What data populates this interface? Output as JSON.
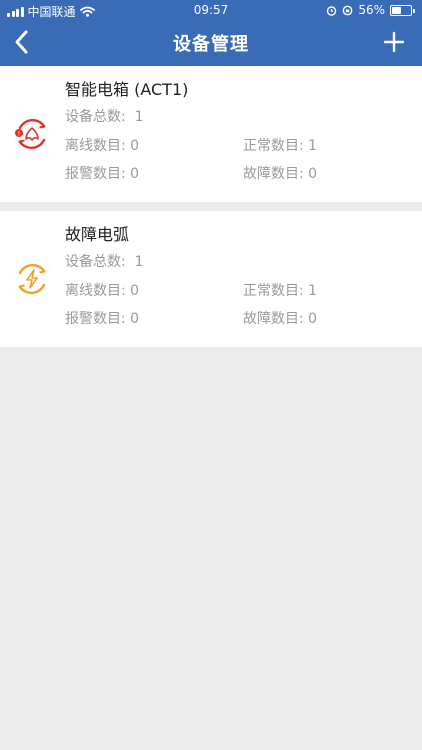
{
  "status_bar": {
    "carrier": "中国联通",
    "time": "09:57",
    "battery": "56%",
    "battery_level": 0.56
  },
  "header": {
    "title": "设备管理",
    "back_icon": "chevron-left-icon",
    "add_icon": "plus-icon"
  },
  "devices": [
    {
      "name": "智能电箱 (ACT1)",
      "icon": "smart-box-icon",
      "color": "#e0332d",
      "total_label": "设备总数:  ",
      "total": "1",
      "offline_label": "离线数目: ",
      "offline": "0",
      "normal_label": "正常数目: ",
      "normal": "1",
      "alarm_label": "报警数目: ",
      "alarm": "0",
      "fault_label": "故障数目: ",
      "fault": "0"
    },
    {
      "name": "故障电弧",
      "icon": "arc-fault-icon",
      "color": "#f0a12b",
      "total_label": "设备总数:  ",
      "total": "1",
      "offline_label": "离线数目: ",
      "offline": "0",
      "normal_label": "正常数目: ",
      "normal": "1",
      "alarm_label": "报警数目: ",
      "alarm": "0",
      "fault_label": "故障数目: ",
      "fault": "0"
    }
  ]
}
